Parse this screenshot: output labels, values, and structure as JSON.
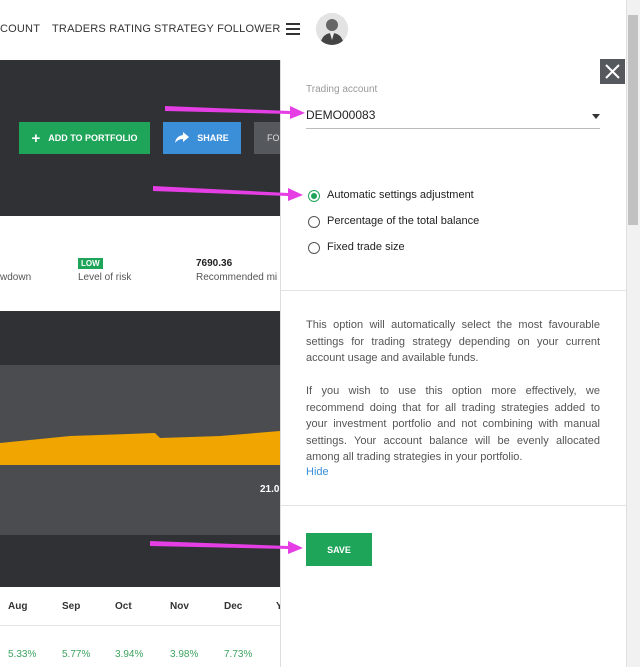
{
  "nav": {
    "items": [
      "COUNT",
      "TRADERS RATING",
      "STRATEGY FOLLOWER"
    ]
  },
  "hero": {
    "add_label": "ADD TO PORTFOLIO",
    "share_label": "SHARE",
    "fo_label": "FO"
  },
  "stats": {
    "drawdown_label": "wdown",
    "risk_badge": "LOW",
    "risk_label": "Level of risk",
    "recommended_value": "7690.36",
    "recommended_label": "Recommended mi"
  },
  "chart": {
    "value_label": "21.0"
  },
  "table": {
    "months": [
      "Aug",
      "Sep",
      "Oct",
      "Nov",
      "Dec",
      "Y"
    ],
    "values": [
      "5.33%",
      "5.77%",
      "3.94%",
      "3.98%",
      "7.73%"
    ]
  },
  "panel": {
    "account_label": "Trading account",
    "account_value": "DEMO00083",
    "options": [
      {
        "label": "Automatic settings adjustment",
        "selected": true
      },
      {
        "label": "Percentage of the total balance",
        "selected": false
      },
      {
        "label": "Fixed trade size",
        "selected": false
      }
    ],
    "desc1": "This option will automatically select the most favourable settings for trading strategy depending on your current account usage and available funds.",
    "desc2": "If you wish to use this option more effectively, we recommend doing that for all trading strategies added to your investment portfolio and not combining with manual settings. Your account balance will be evenly allocated among all trading strategies in your portfolio.",
    "hide_label": "Hide",
    "save_label": "SAVE"
  },
  "colors": {
    "accent_green": "#1fa55a",
    "share_blue": "#3b8fd9",
    "dark_bg": "#2f3135",
    "chart_orange": "#f0a500",
    "arrow_magenta": "#e53ee5",
    "positive_green": "#3ca35f"
  }
}
